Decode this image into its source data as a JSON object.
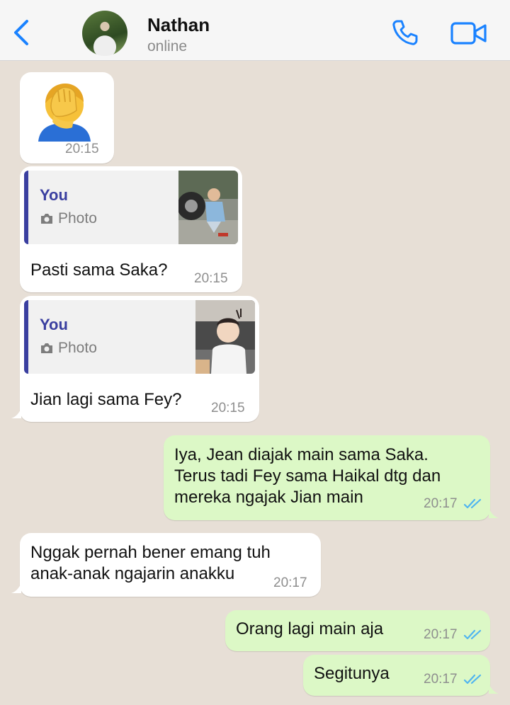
{
  "header": {
    "contact_name": "Nathan",
    "status": "online"
  },
  "messages": [
    {
      "direction": "in",
      "type": "emoji",
      "emoji": "person-facepalming",
      "time": "20:15"
    },
    {
      "direction": "in",
      "type": "reply",
      "quote_sender": "You",
      "quote_type": "Photo",
      "text": "Pasti sama Saka?",
      "time": "20:15"
    },
    {
      "direction": "in",
      "type": "reply",
      "quote_sender": "You",
      "quote_type": "Photo",
      "text": "Jian lagi sama Fey?",
      "time": "20:15"
    },
    {
      "direction": "out",
      "type": "text",
      "text": "Iya, Jean diajak main sama Saka.\nTerus tadi Fey sama Haikal dtg dan\nmereka ngajak Jian main",
      "time": "20:17",
      "status": "read"
    },
    {
      "direction": "in",
      "type": "text",
      "text": "Nggak pernah bener emang tuh\nanak-anak ngajarin anakku",
      "time": "20:17"
    },
    {
      "direction": "out",
      "type": "text",
      "text": "Orang lagi main aja",
      "time": "20:17",
      "status": "read"
    },
    {
      "direction": "out",
      "type": "text",
      "text": "Segitunya",
      "time": "20:17",
      "status": "read"
    }
  ],
  "colors": {
    "accent": "#1a82ff",
    "outgoing_bubble": "#dcf8c6",
    "incoming_bubble": "#ffffff",
    "quote_bar": "#3a3fa0",
    "read_ticks": "#4fb4f0",
    "chat_background": "#e7dfd6"
  }
}
